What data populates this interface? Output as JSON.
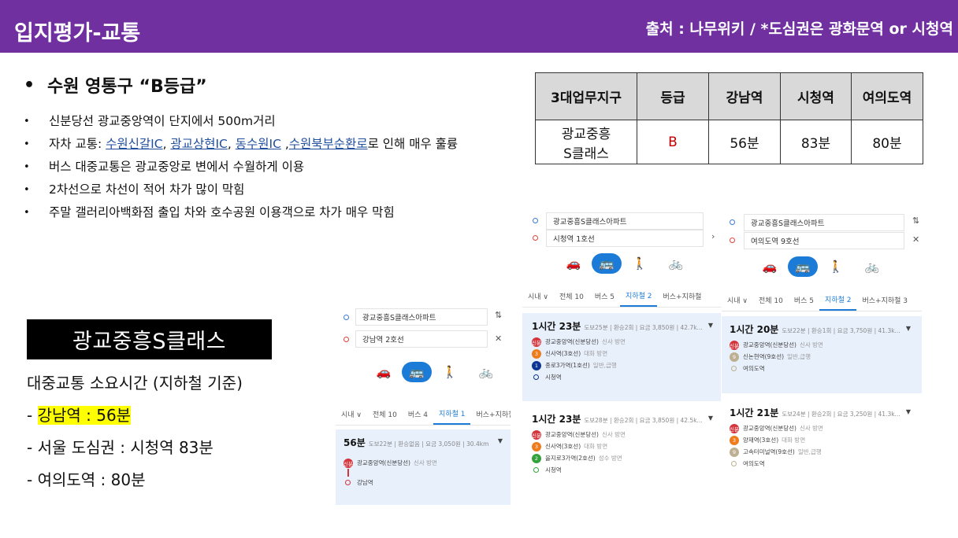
{
  "header": {
    "title": "입지평가-교통",
    "source": "출처 : 나무위키 / *도심권은 광화문역 or 시청역",
    "bg_color": "#7030a0"
  },
  "main_bullet": "수원 영통구 “B등급”",
  "sub_bullets": [
    {
      "text": "신분당선 광교중앙역이 단지에서 500m거리"
    },
    {
      "text": "2차선으로 차선이 적어 차가 많이 막힘"
    },
    {
      "text": "버스 대중교통은 광교중앙로 변에서 수월하게 이용"
    },
    {
      "text": "주말 갤러리아백화점 출입 차와 호수공원 이용객으로 차가 매우 막힘"
    }
  ],
  "car_bullet": {
    "prefix": "자차 교통: ",
    "links": [
      "수원신갈IC",
      "광교상현IC",
      "동수원IC",
      "수원북부순환로"
    ],
    "sep1": ", ",
    "sep2": ", ",
    "sep3": " ,",
    "suffix": "로 인해 매우 훌륭"
  },
  "apt_name": "광교중흥S클래스",
  "transit": {
    "heading": "대중교통 소요시간 (지하철 기준)",
    "gangnam": "강남역 : 56분",
    "cityhall": "서울 도심권 : 시청역 83분",
    "yeouido": "여의도역 : 80분",
    "dash": "- "
  },
  "grade_table": {
    "headers": [
      "3대업무지구",
      "등급",
      "강남역",
      "시청역",
      "여의도역"
    ],
    "row": {
      "name_line1": "광교중흥",
      "name_line2": "S클래스",
      "grade": "B",
      "gangnam": "56분",
      "cityhall": "83분",
      "yeouido": "80분"
    },
    "grade_color": "#c00000"
  },
  "panels": {
    "p1": {
      "from": "광교중흥S클래스아파트",
      "to": "강남역 2호선",
      "tabs": [
        "시내 ∨",
        "전체 10",
        "버스 4",
        "지하철 1",
        "버스+지하철 5"
      ],
      "time": "56분",
      "meta": "도보22분 | 환승없음 | 요금 3,050원 | 30.4km",
      "stops": [
        {
          "badge": "신분",
          "color": "#d4343c",
          "name": "광교중앙역(신분당선)",
          "note": "신사 방면"
        },
        {
          "badge": "",
          "color": "",
          "name": "강남역",
          "note": ""
        }
      ]
    },
    "p2": {
      "from": "광교중흥S클래스아파트",
      "to": "시청역 1호선",
      "tabs": [
        "시내 ∨",
        "전체 10",
        "버스 5",
        "지하철 2",
        "버스+지하철"
      ],
      "routes": [
        {
          "time": "1시간 23분",
          "meta": "도보25분 | 환승2회 | 요금 3,850원 | 42.7k...",
          "stops": [
            {
              "badge": "신분",
              "color": "#d4343c",
              "name": "광교중앙역(신분당선)",
              "note": "신사 방면"
            },
            {
              "badge": "3",
              "color": "#ef7c1c",
              "name": "신사역(3호선)",
              "note": "대화 방면"
            },
            {
              "badge": "1",
              "color": "#0d3692",
              "name": "종로3가역(1호선)",
              "note": "일반,급행"
            },
            {
              "badge": "",
              "color": "",
              "name": "시청역",
              "note": ""
            }
          ]
        },
        {
          "time": "1시간 23분",
          "meta": "도보28분 | 환승2회 | 요금 3,850원 | 42.5k...",
          "stops": [
            {
              "badge": "신분",
              "color": "#d4343c",
              "name": "광교중앙역(신분당선)",
              "note": "신사 방면"
            },
            {
              "badge": "3",
              "color": "#ef7c1c",
              "name": "신사역(3호선)",
              "note": "대화 방면"
            },
            {
              "badge": "2",
              "color": "#33a23d",
              "name": "을지로3가역(2호선)",
              "note": "성수 방면"
            },
            {
              "badge": "",
              "color": "",
              "name": "시청역",
              "note": ""
            }
          ]
        }
      ]
    },
    "p3": {
      "from": "광교중흥S클래스아파트",
      "to": "여의도역 9호선",
      "tabs": [
        "시내 ∨",
        "전체 10",
        "버스 5",
        "지하철 2",
        "버스+지하철 3"
      ],
      "routes": [
        {
          "time": "1시간 20분",
          "meta": "도보22분 | 환승1회 | 요금 3,750원 | 41.3k...",
          "stops": [
            {
              "badge": "신분",
              "color": "#d4343c",
              "name": "광교중앙역(신분당선)",
              "note": "신사 방면"
            },
            {
              "badge": "9",
              "color": "#bdb092",
              "name": "신논현역(9호선)",
              "note": "일반,급행"
            },
            {
              "badge": "",
              "color": "",
              "name": "여의도역",
              "note": ""
            }
          ]
        },
        {
          "time": "1시간 21분",
          "meta": "도보24분 | 환승2회 | 요금 3,250원 | 41.3k...",
          "stops": [
            {
              "badge": "신분",
              "color": "#d4343c",
              "name": "광교중앙역(신분당선)",
              "note": "신사 방면"
            },
            {
              "badge": "3",
              "color": "#ef7c1c",
              "name": "양재역(3호선)",
              "note": "대화 방면"
            },
            {
              "badge": "9",
              "color": "#bdb092",
              "name": "고속터미널역(9호선)",
              "note": "일반,급행"
            },
            {
              "badge": "",
              "color": "",
              "name": "여의도역",
              "note": ""
            }
          ]
        }
      ]
    }
  }
}
